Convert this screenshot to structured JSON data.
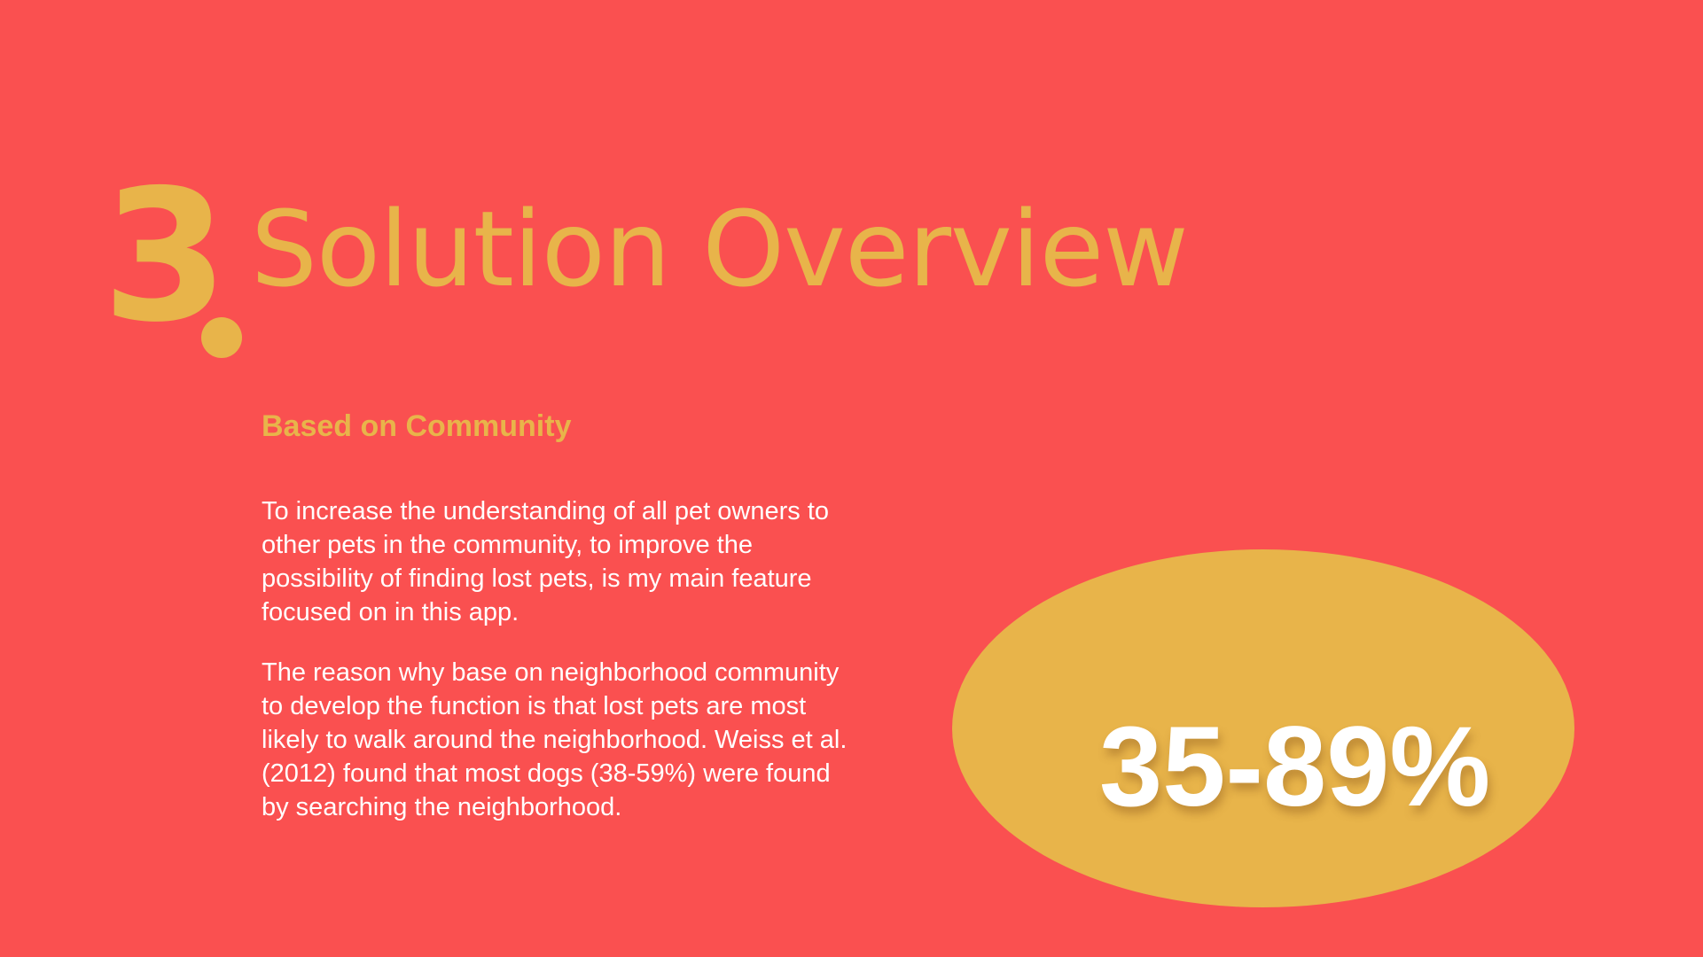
{
  "slide": {
    "section_number": "3",
    "title": "Solution Overview",
    "subtitle": "Based on Community",
    "paragraphs": [
      "To increase the understanding of all pet owners to other pets in the community, to improve the possibility of finding lost pets, is my main feature focused on in this app.",
      "The reason why base on neighborhood community to develop the function is that lost pets are most likely to walk around the neighborhood. Weiss et al. (2012) found that most dogs (38-59%) were found by searching the neighborhood."
    ],
    "highlight_stat": "35-89%"
  },
  "colors": {
    "background": "#fa5050",
    "accent": "#e8b44a",
    "text": "#ffffff"
  }
}
